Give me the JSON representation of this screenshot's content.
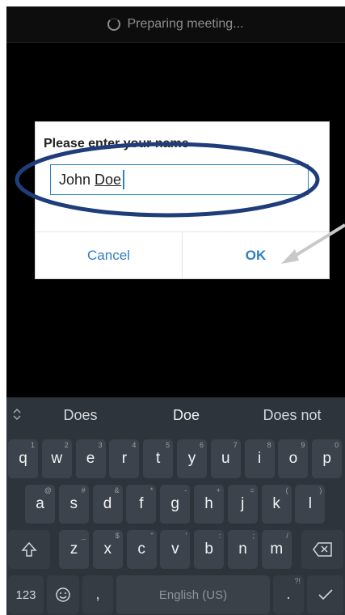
{
  "topbar": {
    "status_text": "Preparing meeting..."
  },
  "dialog": {
    "title": "Please enter your name",
    "input_first": "John",
    "input_last": "Doe",
    "cancel_label": "Cancel",
    "ok_label": "OK"
  },
  "keyboard": {
    "suggestions": [
      "Does",
      "Doe",
      "Does not"
    ],
    "row1": [
      {
        "k": "q",
        "h": "1"
      },
      {
        "k": "w",
        "h": "2"
      },
      {
        "k": "e",
        "h": "3"
      },
      {
        "k": "r",
        "h": "4"
      },
      {
        "k": "t",
        "h": "5"
      },
      {
        "k": "y",
        "h": "6"
      },
      {
        "k": "u",
        "h": "7"
      },
      {
        "k": "i",
        "h": "8"
      },
      {
        "k": "o",
        "h": "9"
      },
      {
        "k": "p",
        "h": "0"
      }
    ],
    "row2": [
      {
        "k": "a",
        "h": "@"
      },
      {
        "k": "s",
        "h": "#"
      },
      {
        "k": "d",
        "h": "&"
      },
      {
        "k": "f",
        "h": "*"
      },
      {
        "k": "g",
        "h": "-"
      },
      {
        "k": "h",
        "h": "+"
      },
      {
        "k": "j",
        "h": "="
      },
      {
        "k": "k",
        "h": "("
      },
      {
        "k": "l",
        "h": ")"
      }
    ],
    "row3": [
      {
        "k": "z",
        "h": "_"
      },
      {
        "k": "x",
        "h": "$"
      },
      {
        "k": "c",
        "h": "\""
      },
      {
        "k": "v",
        "h": "'"
      },
      {
        "k": "b",
        "h": ":"
      },
      {
        "k": "n",
        "h": ";"
      },
      {
        "k": "m",
        "h": "/"
      }
    ],
    "numbers_label": "123",
    "comma_label": ",",
    "space_label": "English (US)",
    "period_label": ".",
    "period_hint": "?!"
  },
  "colors": {
    "accent": "#2d7ec4",
    "annotation": "#1f3d7a",
    "keyboard_bg": "#2d343c"
  }
}
